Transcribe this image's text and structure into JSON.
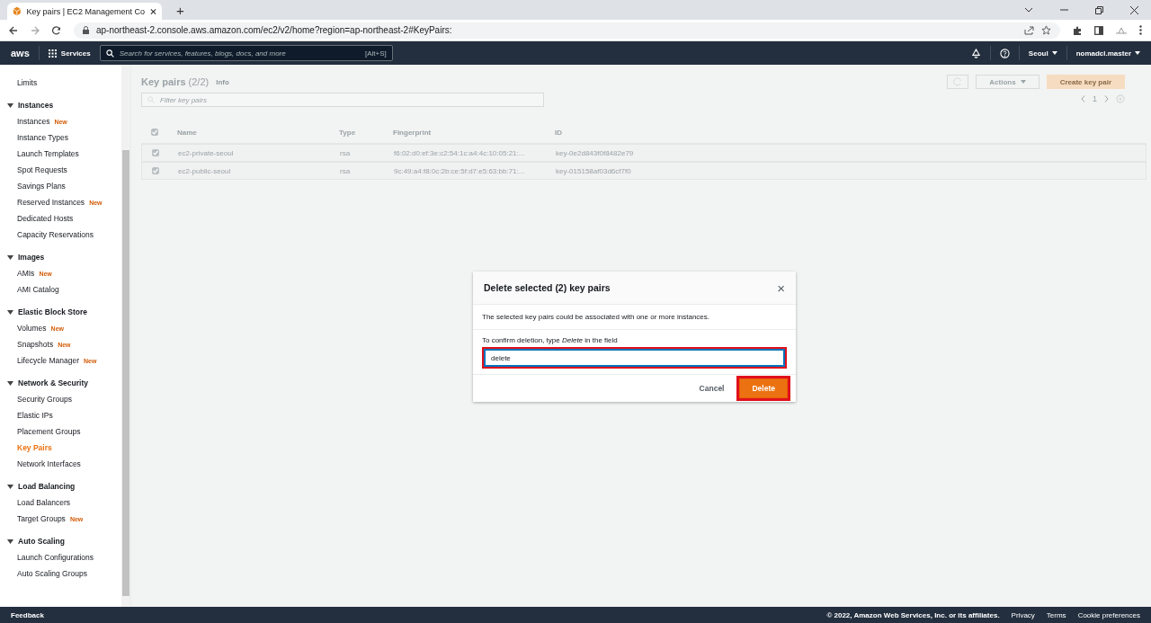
{
  "browser": {
    "tab_title": "Key pairs | EC2 Management Co",
    "new_tab": "+",
    "url": "ap-northeast-2.console.aws.amazon.com/ec2/v2/home?region=ap-northeast-2#KeyPairs:"
  },
  "top_nav": {
    "logo": "aws",
    "services": "Services",
    "search": {
      "placeholder": "Search for services, features, blogs, docs, and more",
      "shortcut": "[Alt+S]"
    },
    "region": "Seoul",
    "account": "nomadcl.master"
  },
  "sidebar": {
    "items": [
      {
        "label": "Limits",
        "selected": false
      }
    ],
    "sections": [
      {
        "title": "Instances",
        "expanded": true,
        "items": [
          {
            "label": "Instances",
            "badge": "New",
            "selected": false
          },
          {
            "label": "Instance Types",
            "selected": false
          },
          {
            "label": "Launch Templates",
            "selected": false
          },
          {
            "label": "Spot Requests",
            "selected": false
          },
          {
            "label": "Savings Plans",
            "selected": false
          },
          {
            "label": "Reserved Instances",
            "badge": "New",
            "selected": false
          },
          {
            "label": "Dedicated Hosts",
            "selected": false
          },
          {
            "label": "Capacity Reservations",
            "selected": false
          }
        ]
      },
      {
        "title": "Images",
        "expanded": true,
        "items": [
          {
            "label": "AMIs",
            "badge": "New",
            "selected": false
          },
          {
            "label": "AMI Catalog",
            "selected": false
          }
        ]
      },
      {
        "title": "Elastic Block Store",
        "expanded": true,
        "items": [
          {
            "label": "Volumes",
            "badge": "New",
            "selected": false
          },
          {
            "label": "Snapshots",
            "badge": "New",
            "selected": false
          },
          {
            "label": "Lifecycle Manager",
            "badge": "New",
            "selected": false
          }
        ]
      },
      {
        "title": "Network & Security",
        "expanded": true,
        "items": [
          {
            "label": "Security Groups",
            "selected": false
          },
          {
            "label": "Elastic IPs",
            "selected": false
          },
          {
            "label": "Placement Groups",
            "selected": false
          },
          {
            "label": "Key Pairs",
            "selected": true
          },
          {
            "label": "Network Interfaces",
            "selected": false
          }
        ]
      },
      {
        "title": "Load Balancing",
        "expanded": true,
        "items": [
          {
            "label": "Load Balancers",
            "selected": false
          },
          {
            "label": "Target Groups",
            "badge": "New",
            "selected": false
          }
        ]
      },
      {
        "title": "Auto Scaling",
        "expanded": true,
        "items": [
          {
            "label": "Launch Configurations",
            "selected": false
          },
          {
            "label": "Auto Scaling Groups",
            "selected": false
          }
        ]
      }
    ]
  },
  "main": {
    "title": "Key pairs",
    "count": "(2/2)",
    "info": "Info",
    "actions": "Actions",
    "create": "Create key pair",
    "filter_placeholder": "Filter key pairs",
    "page": "1",
    "columns": [
      "Name",
      "Type",
      "Fingerprint",
      "ID"
    ],
    "all_checked": true,
    "rows": [
      {
        "checked": true,
        "cells": [
          "ec2-private-seoul",
          "rsa",
          "f6:02:d0:ef:3e:c2:54:1c:a4:4c:10:05:21:...",
          "key-0e2d843f0f8482e79"
        ]
      },
      {
        "checked": true,
        "cells": [
          "ec2-public-seoul",
          "rsa",
          "9c:49:a4:f8:0c:2b:ce:5f:d7:e5:63:bb:71:...",
          "key-015158af03d6cf7f0"
        ]
      }
    ]
  },
  "modal": {
    "title": "Delete selected (2) key pairs",
    "close": "×",
    "message": "The selected key pairs could be associated with one or more instances.",
    "prompt": "To confirm deletion, type *Delete* in the field",
    "value": "delete",
    "field_highlighted": true,
    "cancel": "Cancel",
    "delete": "Delete",
    "delete_highlighted": true
  },
  "footer": {
    "feedback": "Feedback",
    "copyright": "© 2022, Amazon Web Services, Inc. or its affiliates.",
    "links": [
      "Privacy",
      "Terms",
      "Cookie preferences"
    ]
  }
}
